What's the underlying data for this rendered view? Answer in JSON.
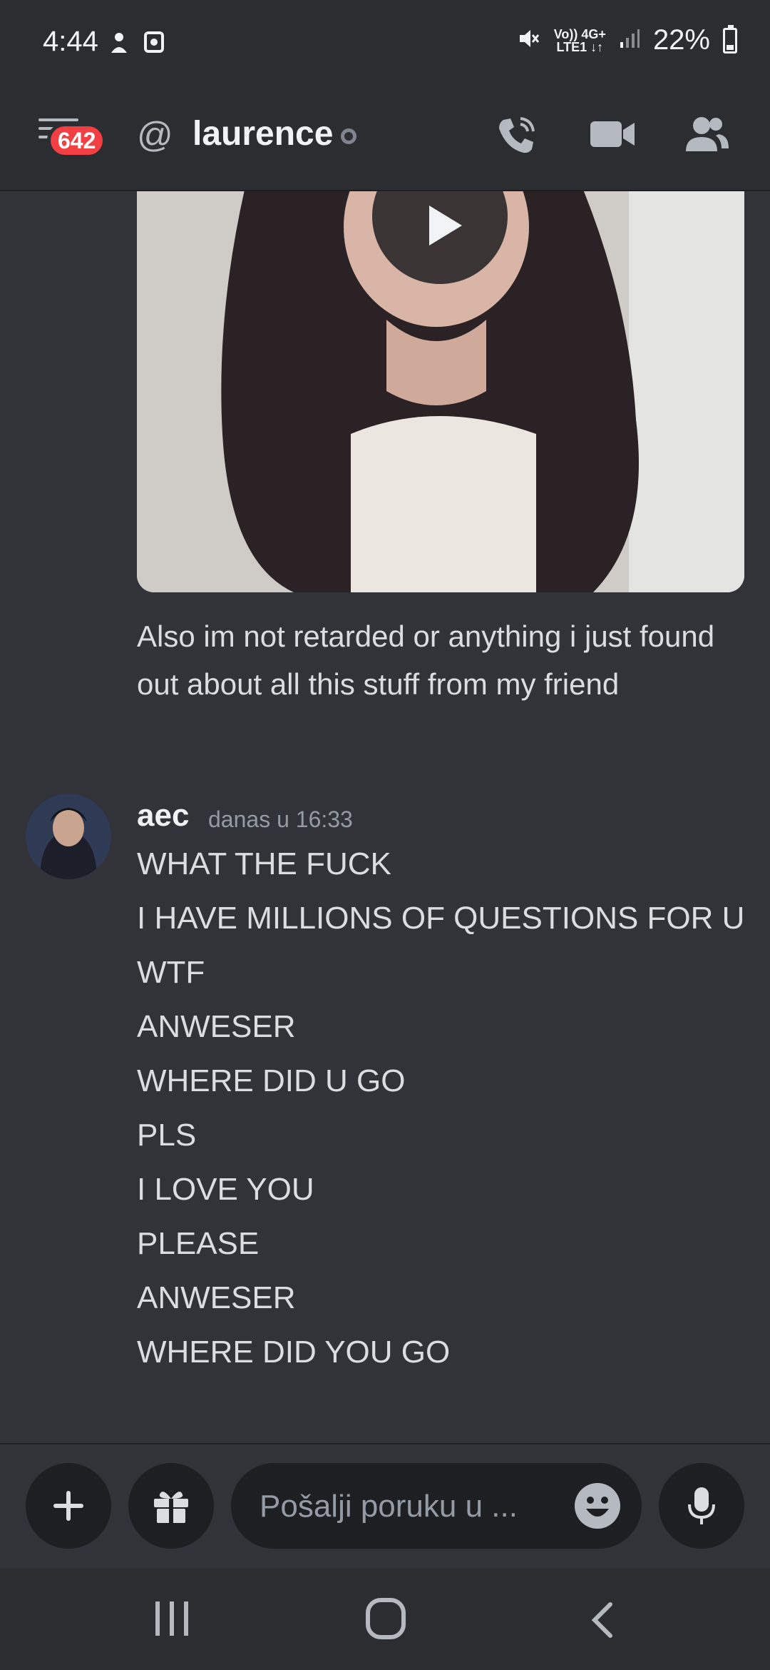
{
  "status_bar": {
    "time": "4:44",
    "network_top": "Vo)) 4G+",
    "network_bottom": "LTE1 ↓↑",
    "battery": "22%"
  },
  "header": {
    "unread_badge": "642",
    "channel_name": "laurence",
    "icons": [
      "menu-icon",
      "at-icon",
      "phone-call-icon",
      "video-call-icon",
      "members-icon"
    ]
  },
  "messages": {
    "previous_text": "Also im not retarded or anything i just found out about all this stuff from my friend",
    "author": "aec",
    "timestamp": "danas u 16:33",
    "lines": [
      "WHAT THE FUCK",
      "I HAVE MILLIONS OF QUESTIONS FOR U",
      "WTF",
      "ANWESER",
      "WHERE DID U GO",
      "PLS",
      "I LOVE YOU",
      "PLEASE",
      "ANWESER",
      "WHERE DID YOU GO"
    ]
  },
  "composer": {
    "placeholder": "Pošalji poruku u ..."
  },
  "colors": {
    "background": "#313338",
    "header": "#2b2d31",
    "badge": "#f23f43"
  }
}
